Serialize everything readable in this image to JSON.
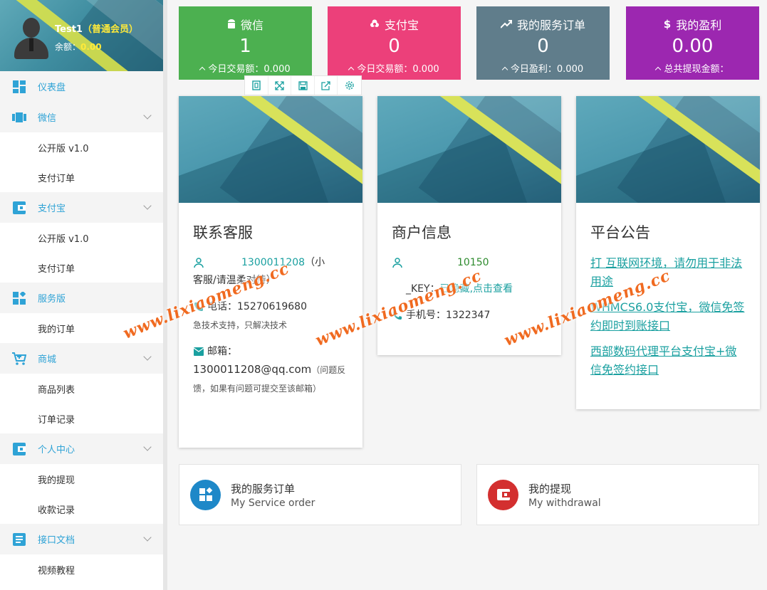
{
  "user": {
    "name": "Test1",
    "level": "（普通会员）",
    "balance_label": "余额：",
    "balance": "0.00"
  },
  "sidebar": {
    "groups": [
      {
        "label": "仪表盘",
        "icon": "dashboard-icon",
        "expandable": false,
        "items": []
      },
      {
        "label": "微信",
        "icon": "wechat-icon",
        "expandable": true,
        "items": [
          "公开版 v1.0",
          "支付订单"
        ]
      },
      {
        "label": "支付宝",
        "icon": "wallet-icon",
        "expandable": true,
        "items": [
          "公开版 v1.0",
          "支付订单"
        ]
      },
      {
        "label": "服务版",
        "icon": "grid-icon",
        "expandable": false,
        "items": [
          "我的订单"
        ]
      },
      {
        "label": "商城",
        "icon": "cart-icon",
        "expandable": true,
        "items": [
          "商品列表",
          "订单记录"
        ]
      },
      {
        "label": "个人中心",
        "icon": "wallet-icon",
        "expandable": true,
        "items": [
          "我的提现",
          "收款记录"
        ]
      },
      {
        "label": "接口文档",
        "icon": "doc-icon",
        "expandable": true,
        "items": [
          "视频教程"
        ]
      }
    ]
  },
  "stats": [
    {
      "title": "微信",
      "value": "1",
      "sub": "今日交易额：0.000",
      "color": "#4cb050",
      "icon": "android-icon"
    },
    {
      "title": "支付宝",
      "value": "0",
      "sub": "今日交易额：0.000",
      "color": "#ec407a",
      "icon": "flower-icon"
    },
    {
      "title": "我的服务订单",
      "value": "0",
      "sub": "今日盈利：0.000",
      "color": "#607d8b",
      "icon": "trend-icon"
    },
    {
      "title": "我的盈利",
      "value": "0.00",
      "sub": "总共提现金额：",
      "color": "#9c27b0",
      "icon": "dollar-icon"
    }
  ],
  "toolbar": [
    "copy-icon",
    "expand-icon",
    "save-icon",
    "share-icon",
    "settings-icon"
  ],
  "contact": {
    "title": "联系客服",
    "qq": "1300011208",
    "qq_note": "（小",
    "qq_note2": "客服/请温柔对待）",
    "phone_label": "电话：",
    "phone": "15270619680",
    "phone_note": "急技术支持，只解决技术",
    "email_label": "邮箱：",
    "email": "1300011208@qq.com",
    "email_note": "（问题反馈，如果有问题可提交至该邮箱）"
  },
  "merchant": {
    "title": "商户信息",
    "id_value": "10150",
    "key_label": "_KEY：",
    "key_value": "已隐藏,点击查看",
    "mobile_label": "手机号：",
    "mobile": "1322347"
  },
  "notice": {
    "title": "平台公告",
    "links": [
      "打        互联网环境，请勿用于非法用途",
      "WHMCS6.0支付宝，微信免签约即时到账接口",
      "西部数码代理平台支付宝+微信免签约接口"
    ]
  },
  "bottom": [
    {
      "title": "我的服务订单",
      "subtitle": "My Service order",
      "color": "#1e88c8",
      "icon": "grid-icon"
    },
    {
      "title": "我的提现",
      "subtitle": "My withdrawal",
      "color": "#d32f2f",
      "icon": "wallet-icon"
    }
  ],
  "watermark": "www.lixiaomeng.cc"
}
